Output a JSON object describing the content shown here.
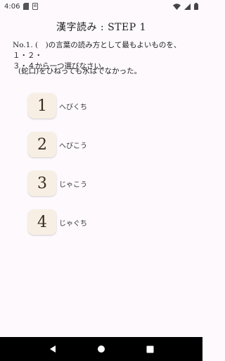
{
  "status_bar": {
    "time": "4:06"
  },
  "title": "漢字読み : STEP 1",
  "question": {
    "line1": "No.1. (　)の言葉の読み方として最もよいものを、１・２・",
    "line2": "３・４から一つ選びなさい。",
    "sentence": "(蛇口)をひねっても水はでなかった。"
  },
  "choices": [
    {
      "number": "1",
      "label": "へびくち"
    },
    {
      "number": "2",
      "label": "へびこう"
    },
    {
      "number": "3",
      "label": "じゃこう"
    },
    {
      "number": "4",
      "label": "じゃぐち"
    }
  ],
  "colors": {
    "background": "#fdf9fc",
    "choice_bg": "#f8efe4",
    "nav_bar": "#000000"
  },
  "icons": {
    "status_left": [
      "sd-card-icon",
      "storage-icon"
    ],
    "status_right": [
      "wifi-icon",
      "signal-icon",
      "battery-icon"
    ],
    "nav": [
      "back-icon",
      "home-icon",
      "recents-icon"
    ]
  }
}
